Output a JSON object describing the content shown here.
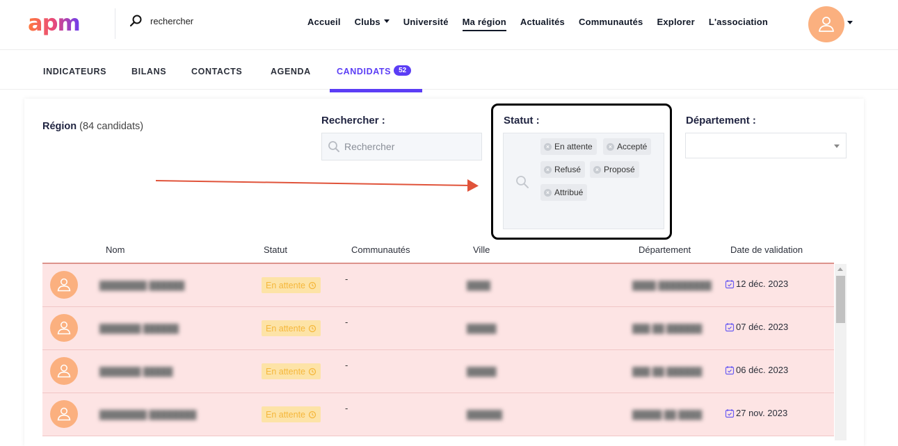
{
  "header": {
    "search_text": "rechercher",
    "nav": [
      {
        "label": "Accueil"
      },
      {
        "label": "Clubs"
      },
      {
        "label": "Université"
      },
      {
        "label": "Ma région"
      },
      {
        "label": "Actualités"
      },
      {
        "label": "Communautés"
      },
      {
        "label": "Explorer"
      },
      {
        "label": "L'association"
      }
    ]
  },
  "tabs": [
    {
      "label": "INDICATEURS"
    },
    {
      "label": "BILANS"
    },
    {
      "label": "CONTACTS"
    },
    {
      "label": "AGENDA"
    },
    {
      "label": "CANDIDATS",
      "badge": "52"
    }
  ],
  "filters": {
    "region_label": "Région",
    "region_count": "(84 candidats)",
    "search_label": "Rechercher :",
    "search_placeholder": "Rechercher",
    "statut_label": "Statut :",
    "statut_chips": [
      "En attente",
      "Accepté",
      "Refusé",
      "Proposé",
      "Attribué"
    ],
    "departement_label": "Département :"
  },
  "table": {
    "headers": [
      "Nom",
      "Statut",
      "Communautés",
      "Ville",
      "Département",
      "Date de validation"
    ],
    "rows": [
      {
        "status": "En attente",
        "communautes": "-",
        "date": "12 déc. 2023"
      },
      {
        "status": "En attente",
        "communautes": "-",
        "date": "07 déc. 2023"
      },
      {
        "status": "En attente",
        "communautes": "-",
        "date": "06 déc. 2023"
      },
      {
        "status": "En attente",
        "communautes": "-",
        "date": "27 nov. 2023"
      }
    ]
  },
  "colors": {
    "accent": "#5b3df5",
    "avatar": "#fbb07f",
    "row_bg": "#fde4e4",
    "status_bg": "#fde3a7",
    "annotation_arrow": "#e0533a"
  }
}
